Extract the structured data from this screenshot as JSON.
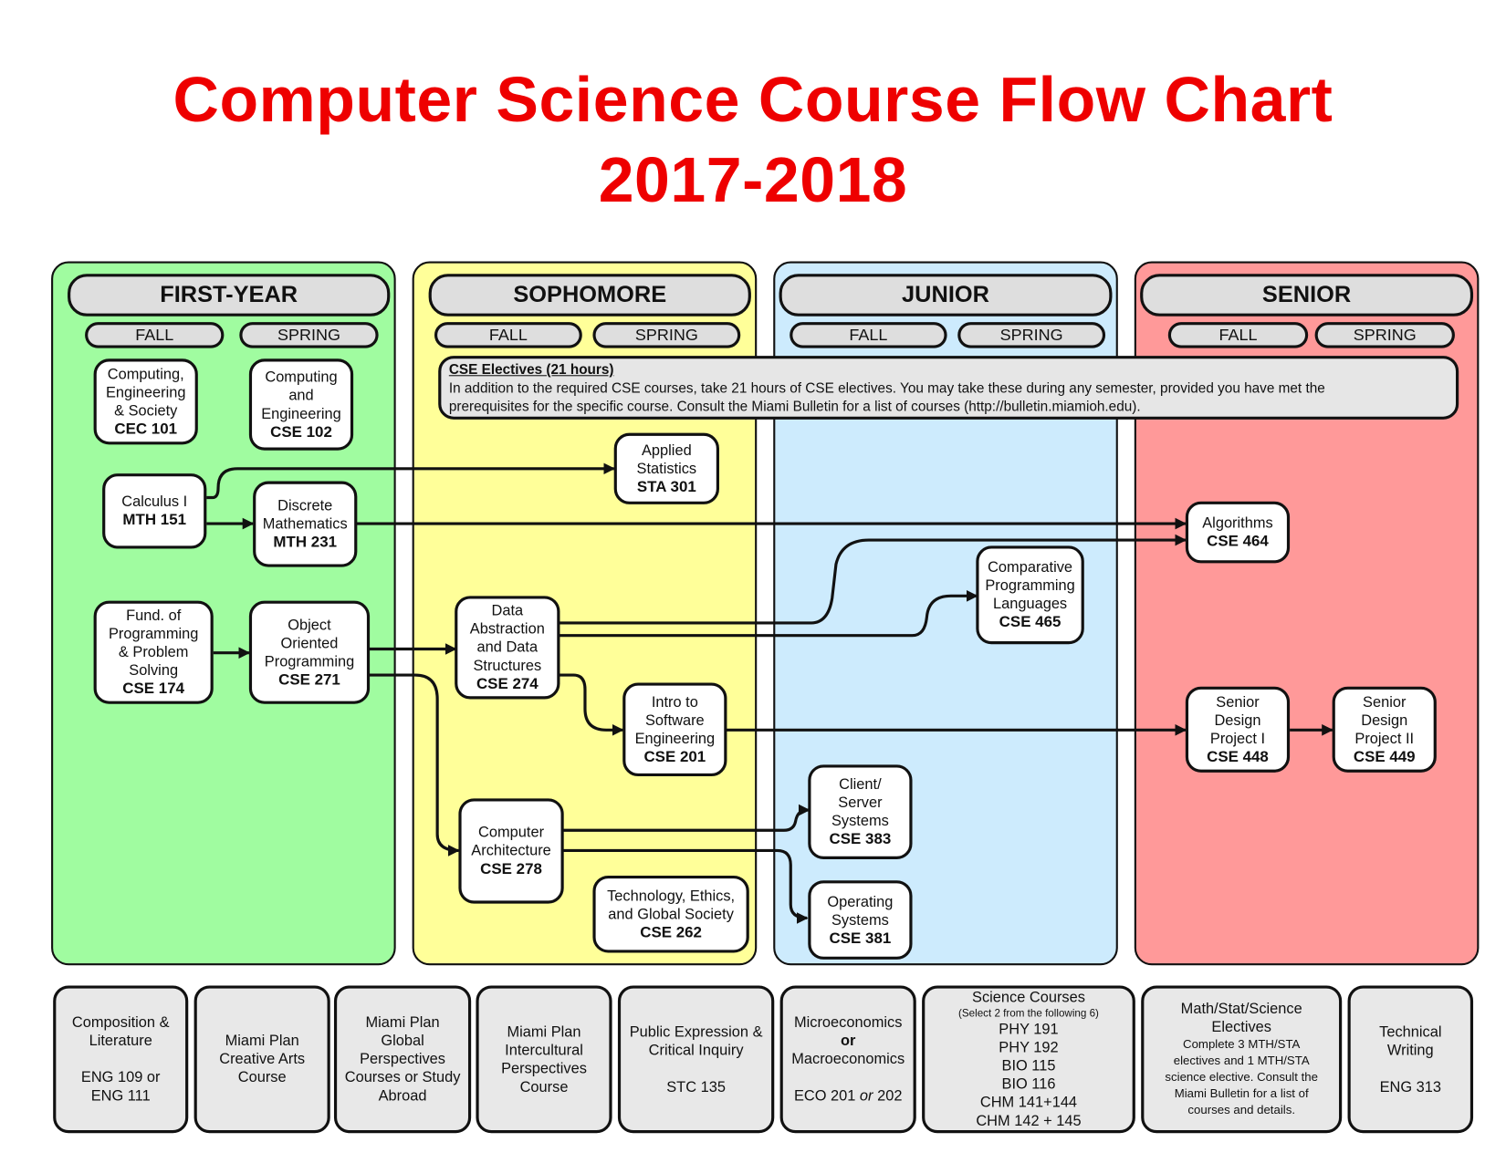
{
  "title": {
    "line1": "Computer Science Course Flow Chart",
    "line2": "2017-2018",
    "color": "#ee0000"
  },
  "years": [
    {
      "label": "FIRST-YEAR",
      "color": "#a0fca0",
      "fall": "FALL",
      "spring": "SPRING"
    },
    {
      "label": "SOPHOMORE",
      "color": "#ffff99",
      "fall": "FALL",
      "spring": "SPRING"
    },
    {
      "label": "JUNIOR",
      "color": "#cdebfd",
      "fall": "FALL",
      "spring": "SPRING"
    },
    {
      "label": "SENIOR",
      "color": "#ff9999",
      "fall": "FALL",
      "spring": "SPRING"
    }
  ],
  "electives": {
    "heading": "CSE Electives (21 hours)",
    "line1": "In addition to the required CSE courses, take 21 hours of CSE electives.  You may take these during any semester, provided you have met the",
    "line2": "prerequisites for the specific course.  Consult the Miami Bulletin for a list of courses (http://bulletin.miamioh.edu)."
  },
  "courses": {
    "cec101": {
      "name": [
        "Computing,",
        "Engineering",
        "& Society"
      ],
      "code": "CEC 101"
    },
    "cse102": {
      "name": [
        "Computing",
        "and",
        "Engineering"
      ],
      "code": "CSE 102"
    },
    "mth151": {
      "name": [
        "Calculus I"
      ],
      "code": "MTH 151"
    },
    "mth231": {
      "name": [
        "Discrete",
        "Mathematics"
      ],
      "code": "MTH 231"
    },
    "cse174": {
      "name": [
        "Fund. of",
        "Programming",
        "& Problem",
        "Solving"
      ],
      "code": "CSE 174"
    },
    "cse271": {
      "name": [
        "Object",
        "Oriented",
        "Programming"
      ],
      "code": "CSE 271"
    },
    "sta301": {
      "name": [
        "Applied",
        "Statistics"
      ],
      "code": "STA 301"
    },
    "cse274": {
      "name": [
        "Data",
        "Abstraction",
        "and Data",
        "Structures"
      ],
      "code": "CSE 274"
    },
    "cse201": {
      "name": [
        "Intro to",
        "Software",
        "Engineering"
      ],
      "code": "CSE 201"
    },
    "cse278": {
      "name": [
        "Computer",
        "Architecture"
      ],
      "code": "CSE 278"
    },
    "cse262": {
      "name": [
        "Technology, Ethics,",
        "and Global Society"
      ],
      "code": "CSE 262"
    },
    "cse465": {
      "name": [
        "Comparative",
        "Programming",
        "Languages"
      ],
      "code": "CSE 465"
    },
    "cse383": {
      "name": [
        "Client/",
        "Server",
        "Systems"
      ],
      "code": "CSE 383"
    },
    "cse381": {
      "name": [
        "Operating",
        "Systems"
      ],
      "code": "CSE 381"
    },
    "cse464": {
      "name": [
        "Algorithms"
      ],
      "code": "CSE 464"
    },
    "cse448": {
      "name": [
        "Senior",
        "Design",
        "Project I"
      ],
      "code": "CSE 448"
    },
    "cse449": {
      "name": [
        "Senior",
        "Design",
        "Project II"
      ],
      "code": "CSE 449"
    }
  },
  "prerequisites": [
    {
      "from": "MTH 151",
      "to": "STA 301"
    },
    {
      "from": "MTH 151",
      "to": "MTH 231"
    },
    {
      "from": "MTH 231",
      "to": "CSE 464"
    },
    {
      "from": "CSE 174",
      "to": "CSE 271"
    },
    {
      "from": "CSE 271",
      "to": "CSE 274"
    },
    {
      "from": "CSE 271",
      "to": "CSE 278"
    },
    {
      "from": "CSE 274",
      "to": "CSE 464"
    },
    {
      "from": "CSE 274",
      "to": "CSE 465"
    },
    {
      "from": "CSE 274",
      "to": "CSE 201"
    },
    {
      "from": "CSE 201",
      "to": "CSE 448"
    },
    {
      "from": "CSE 448",
      "to": "CSE 449"
    },
    {
      "from": "CSE 278",
      "to": "CSE 383"
    },
    {
      "from": "CSE 278",
      "to": "CSE 381"
    }
  ],
  "requirements": {
    "comp": {
      "l1": "Composition &",
      "l2": "Literature",
      "l3": "ENG 109 or",
      "l4": "ENG 111"
    },
    "arts": {
      "l1": "Miami Plan",
      "l2": "Creative Arts",
      "l3": "Course"
    },
    "global": {
      "l1": "Miami Plan",
      "l2": "Global",
      "l3": "Perspectives",
      "l4": "Courses or Study",
      "l5": "Abroad"
    },
    "intercultural": {
      "l1": "Miami Plan",
      "l2": "Intercultural",
      "l3": "Perspectives",
      "l4": "Course"
    },
    "public": {
      "l1": "Public Expression &",
      "l2": "Critical Inquiry",
      "l3": "STC 135"
    },
    "econ": {
      "l1": "Microeconomics",
      "or": "or",
      "l2": "Macroeconomics",
      "code_a": "ECO 201 ",
      "code_or": "or",
      "code_b": " 202"
    },
    "science": {
      "title": "Science Courses",
      "note": "(Select 2 from the following 6)",
      "items": [
        "PHY 191",
        "PHY 192",
        "BIO 115",
        "BIO 116",
        "CHM 141+144",
        "CHM 142 + 145"
      ]
    },
    "mathstat": {
      "l1": "Math/Stat/Science",
      "l2": "Electives",
      "d1": "Complete 3 MTH/STA",
      "d2": "electives and 1 MTH/STA",
      "d3": "science elective. Consult the",
      "d4": "Miami Bulletin for a list of",
      "d5": "courses and details."
    },
    "tech": {
      "l1": "Technical",
      "l2": "Writing",
      "l3": "ENG 313"
    }
  }
}
